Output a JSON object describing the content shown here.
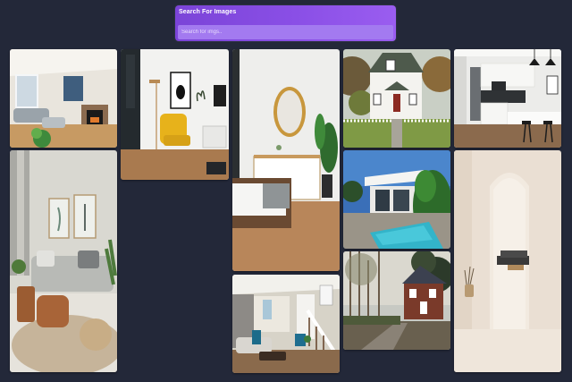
{
  "search": {
    "title": "Search For Images",
    "placeholder": "Search for imgs.."
  },
  "gallery": {
    "images": [
      {
        "name": "living-room-fireplace"
      },
      {
        "name": "living-room-jute-rug"
      },
      {
        "name": "yellow-chair-corner"
      },
      {
        "name": "bedroom-round-mirror"
      },
      {
        "name": "staircase-living-room"
      },
      {
        "name": "white-cottage-exterior"
      },
      {
        "name": "modern-house-pool"
      },
      {
        "name": "brick-house-forest"
      },
      {
        "name": "modern-white-kitchen"
      },
      {
        "name": "beige-arch-room"
      }
    ]
  },
  "colors": {
    "background": "#232839",
    "search_gradient_start": "#7b44d8",
    "search_gradient_end": "#9a5df0"
  }
}
